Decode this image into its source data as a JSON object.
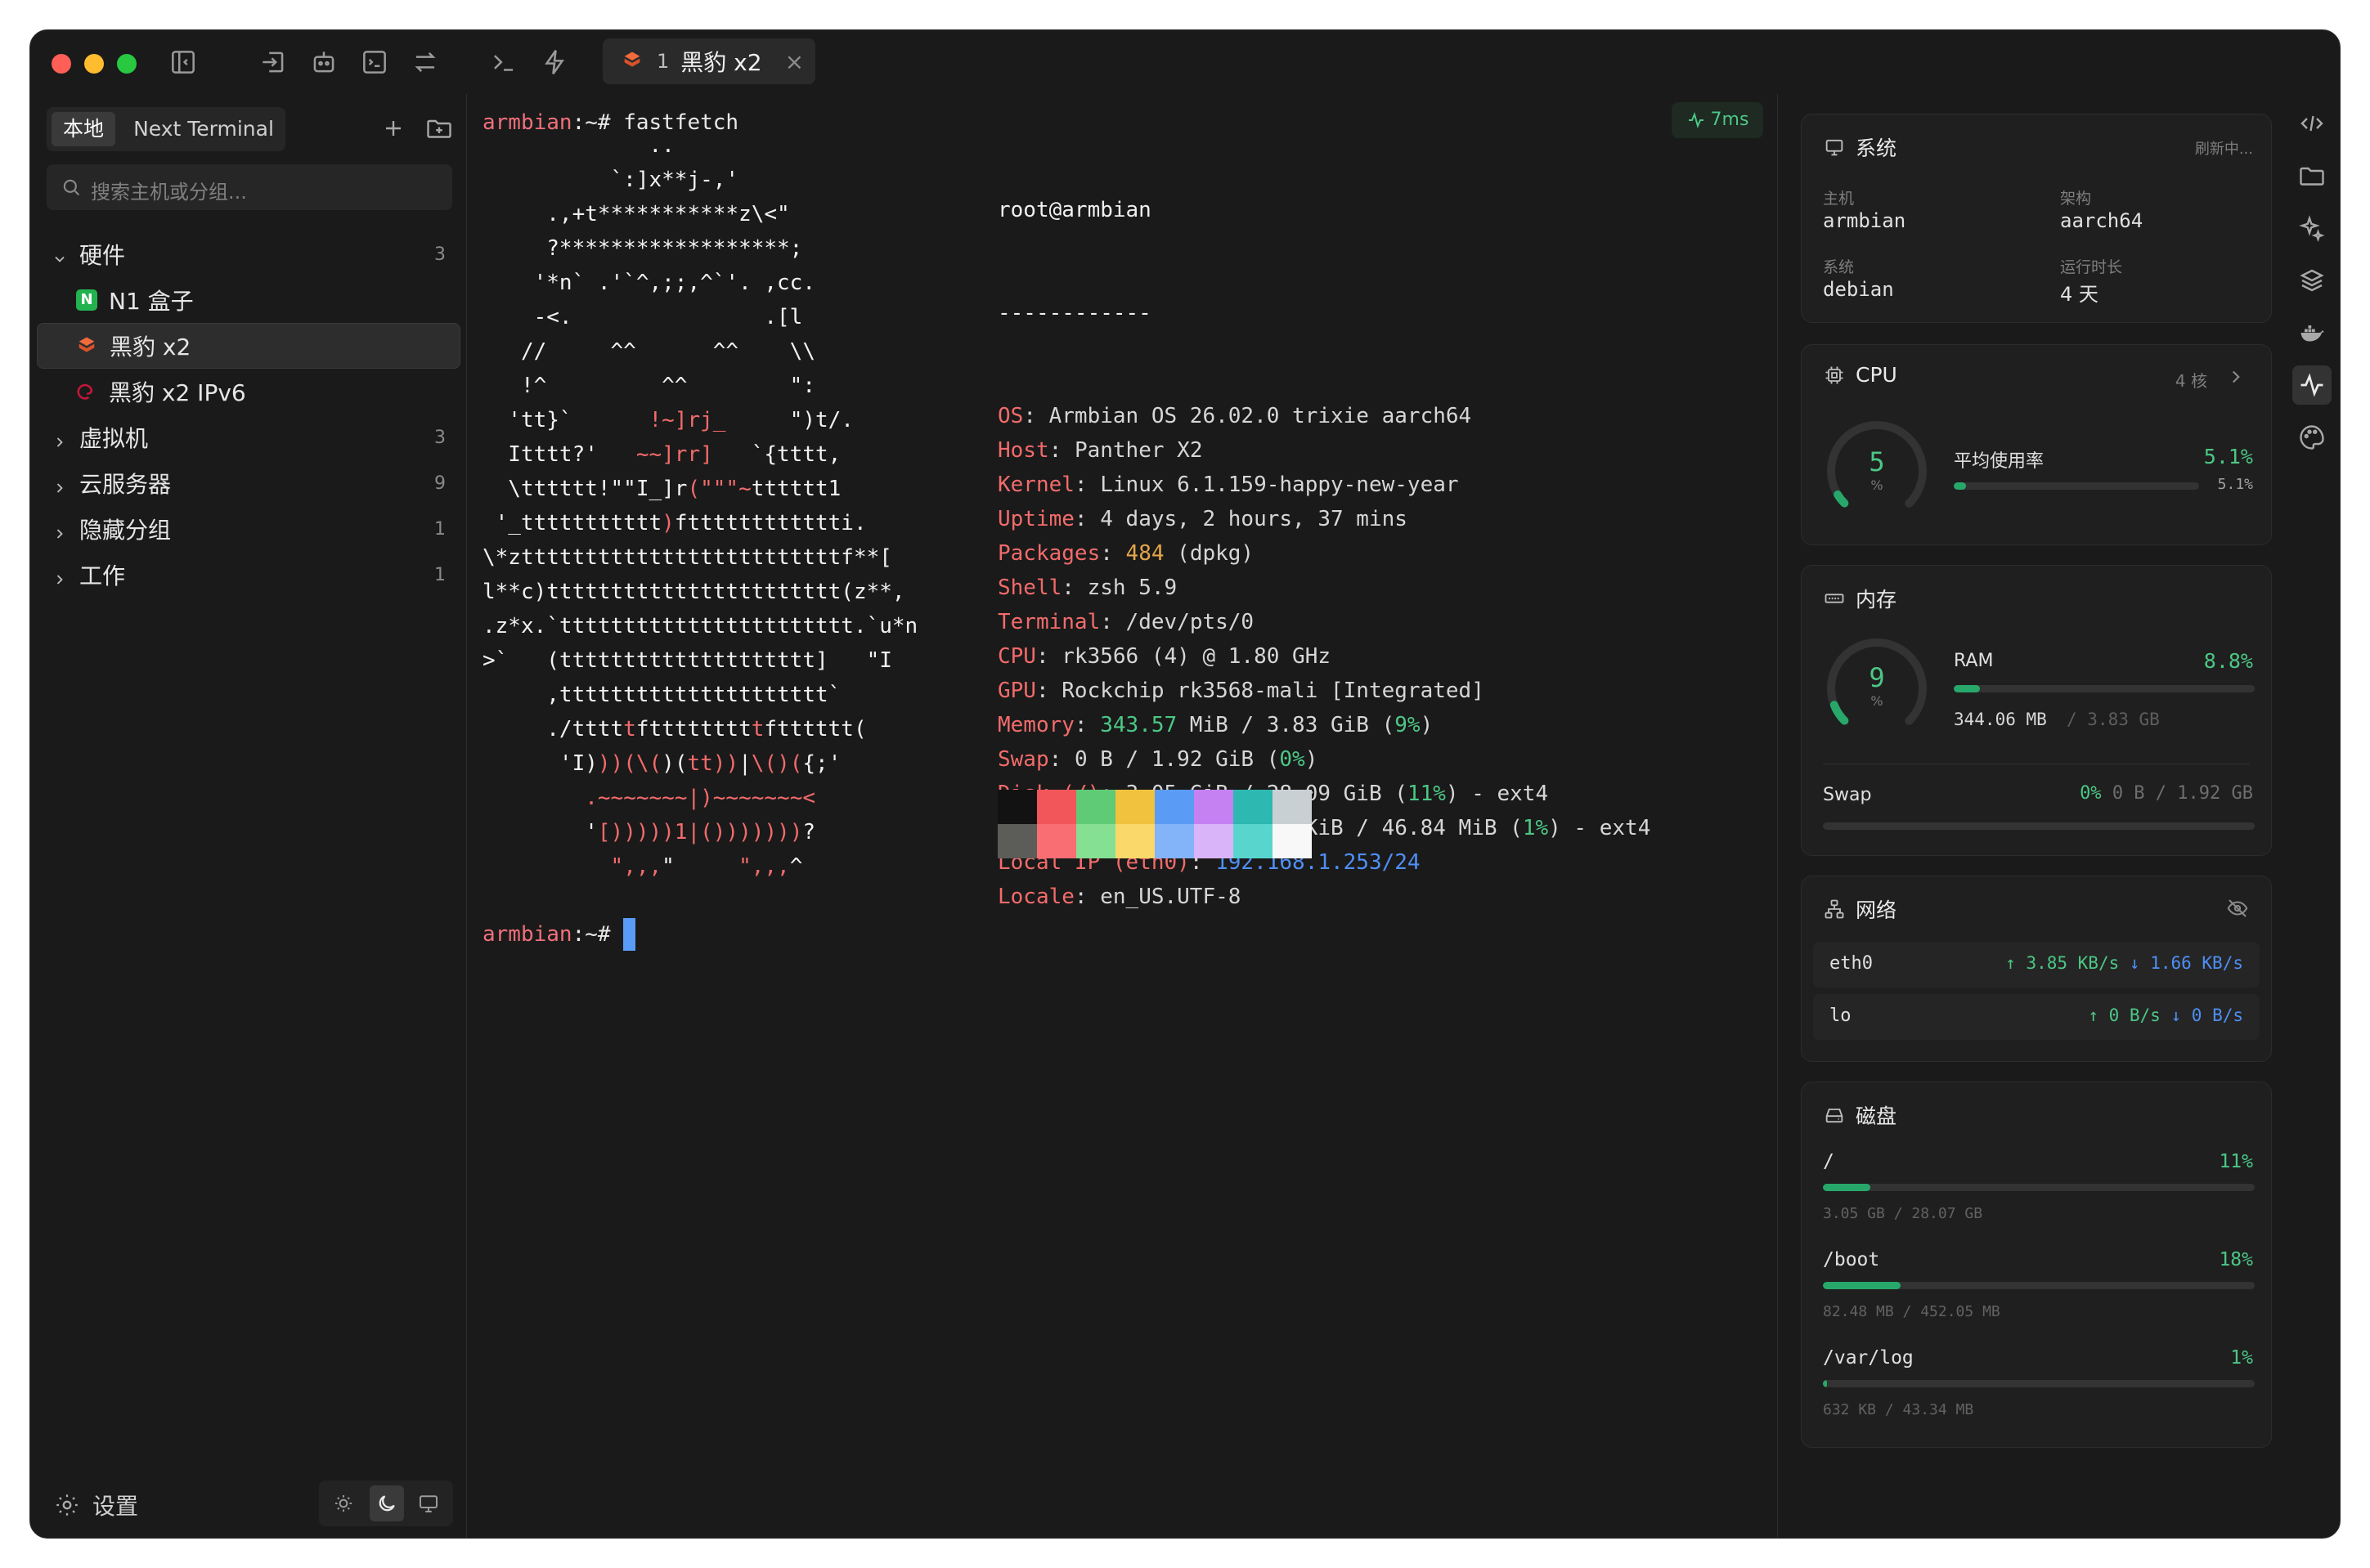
{
  "window": {
    "tab": {
      "index": "1",
      "title": "黑豹 x2",
      "close": "×"
    },
    "traffic_colors": [
      "#ff5f57",
      "#febc2e",
      "#28c840"
    ]
  },
  "sidebar": {
    "seg_local": "本地",
    "seg_next": "Next Terminal",
    "search_placeholder": "搜索主机或分组...",
    "groups": [
      {
        "label": "硬件",
        "count": "3",
        "expanded": true,
        "hosts": [
          {
            "label": "N1 盒子",
            "icon": "n-badge-icon"
          },
          {
            "label": "黑豹 x2",
            "icon": "armbian-icon"
          },
          {
            "label": "黑豹 x2 IPv6",
            "icon": "debian-icon"
          }
        ]
      },
      {
        "label": "虚拟机",
        "count": "3"
      },
      {
        "label": "云服务器",
        "count": "9"
      },
      {
        "label": "隐藏分组",
        "count": "1"
      },
      {
        "label": "工作",
        "count": "1"
      }
    ],
    "settings": "设置"
  },
  "terminal": {
    "prompt_host": "armbian",
    "prompt_rest": ":~# ",
    "command": "fastfetch",
    "latency": "7ms",
    "logo": [
      "             ..",
      "          `:]x**j-,'",
      "     .,+t***********z\\<\"",
      "     ?******************;",
      "    '*n` .'`^,;;,^`'. ,cc.",
      "    -<.               .[l",
      "   //     ^^      ^^    \\\\",
      "   !^         ^^        \":",
      "  'tt}`      !~]rj_     \")t/.",
      "  Itttt?'   ~~]rr]   `{tttt,",
      "  \\tttttt!\"\"I_]r(\"\"\"~tttttt1",
      " '_ttttttttttt)ftttttttttttti.",
      "\\*ztttttttttttttttttttttttttf**[",
      "l**c)ttttttttttttttttttttttt(z**,",
      ".z*x.`ttttttttttttttttttttttt.`u*n",
      ">`   (tttttttttttttttttttt]   \"I",
      "     ,ttttttttttttttttttttt`",
      "     ./tttttftttttttttftttttt(",
      "      'I)))(\\()(tt))|\\()({;'",
      "        .~~~~~~~|)~~~~~~~<",
      "        '[)))))1|()))))))?",
      "          \",,,\"     \",,,^"
    ],
    "user": "root@armbian",
    "sep": "------------",
    "info": [
      {
        "k": "OS",
        "v": "Armbian OS 26.02.0 trixie aarch64"
      },
      {
        "k": "Host",
        "v": "Panther X2"
      },
      {
        "k": "Kernel",
        "v": "Linux 6.1.159-happy-new-year"
      },
      {
        "k": "Uptime",
        "v": "4 days, 2 hours, 37 mins"
      },
      {
        "k": "Packages",
        "v1": "484",
        "v2": " (dpkg)"
      },
      {
        "k": "Shell",
        "v": "zsh 5.9"
      },
      {
        "k": "Terminal",
        "v": "/dev/pts/0"
      },
      {
        "k": "CPU",
        "v": "rk3566 (4) @ 1.80 GHz"
      },
      {
        "k": "GPU",
        "v": "Rockchip rk3568-mali [Integrated]"
      },
      {
        "k": "Memory",
        "v1": "343.57",
        "v2": " MiB / 3.83 GiB (",
        "v3": "9%",
        "v4": ")"
      },
      {
        "k": "Swap",
        "v2": "0 B / 1.92 GiB (",
        "v3": "0%",
        "v4": ")"
      },
      {
        "k": "Disk (/)",
        "v2": "3.05 GiB / 28.09 GiB (",
        "v3": "11%",
        "v4": ") - ext4"
      },
      {
        "k": "Disk (/var/log)",
        "v2": "632.00 KiB / 46.84 MiB (",
        "v3": "1%",
        "v4": ") - ext4"
      },
      {
        "k": "Local IP (eth0)",
        "v": "192.168.1.253/24"
      },
      {
        "k": "Locale",
        "v": "en_US.UTF-8"
      }
    ],
    "palette_top": [
      "#121212",
      "#f2555a",
      "#5fcb77",
      "#f0c23e",
      "#5a9bf5",
      "#c580f2",
      "#2db8b1",
      "#c9d0d3"
    ],
    "palette_bottom": [
      "#5c5c58",
      "#f86e73",
      "#86e093",
      "#fbd86a",
      "#83b3f8",
      "#d9b4f8",
      "#58d6cd",
      "#f8f8f8"
    ]
  },
  "panel": {
    "system": {
      "title": "系统",
      "status": "刷新中...",
      "host_label": "主机",
      "host": "armbian",
      "arch_label": "架构",
      "arch": "aarch64",
      "os_label": "系统",
      "os": "debian",
      "uptime_label": "运行时长",
      "uptime": "4 天"
    },
    "cpu": {
      "title": "CPU",
      "cores": "4 核",
      "gauge": "5",
      "gauge_unit": "%",
      "avg_label": "平均使用率",
      "avg": "5.1%",
      "core_value": "5.1%",
      "percent": 5.1
    },
    "memory": {
      "title": "内存",
      "gauge": "9",
      "gauge_unit": "%",
      "ram_label": "RAM",
      "ram_pct": "8.8%",
      "percent": 8.8,
      "ram_used": "344.06 MB",
      "ram_total": "/ 3.83 GB",
      "swap_label": "Swap",
      "swap_pct": "0%",
      "swap_detail": "0 B / 1.92 GB",
      "swap_percent": 0
    },
    "network": {
      "title": "网络",
      "ifaces": [
        {
          "name": "eth0",
          "up": "3.85 KB/s",
          "down": "1.66 KB/s"
        },
        {
          "name": "lo",
          "up": "0 B/s",
          "down": "0 B/s"
        }
      ]
    },
    "disk": {
      "title": "磁盘",
      "mounts": [
        {
          "path": "/",
          "pct": "11%",
          "percent": 11,
          "detail": "3.05 GB / 28.07 GB"
        },
        {
          "path": "/boot",
          "pct": "18%",
          "percent": 18,
          "detail": "82.48 MB / 452.05 MB"
        },
        {
          "path": "/var/log",
          "pct": "1%",
          "percent": 1,
          "detail": "632 KB / 43.34 MB"
        }
      ]
    }
  }
}
